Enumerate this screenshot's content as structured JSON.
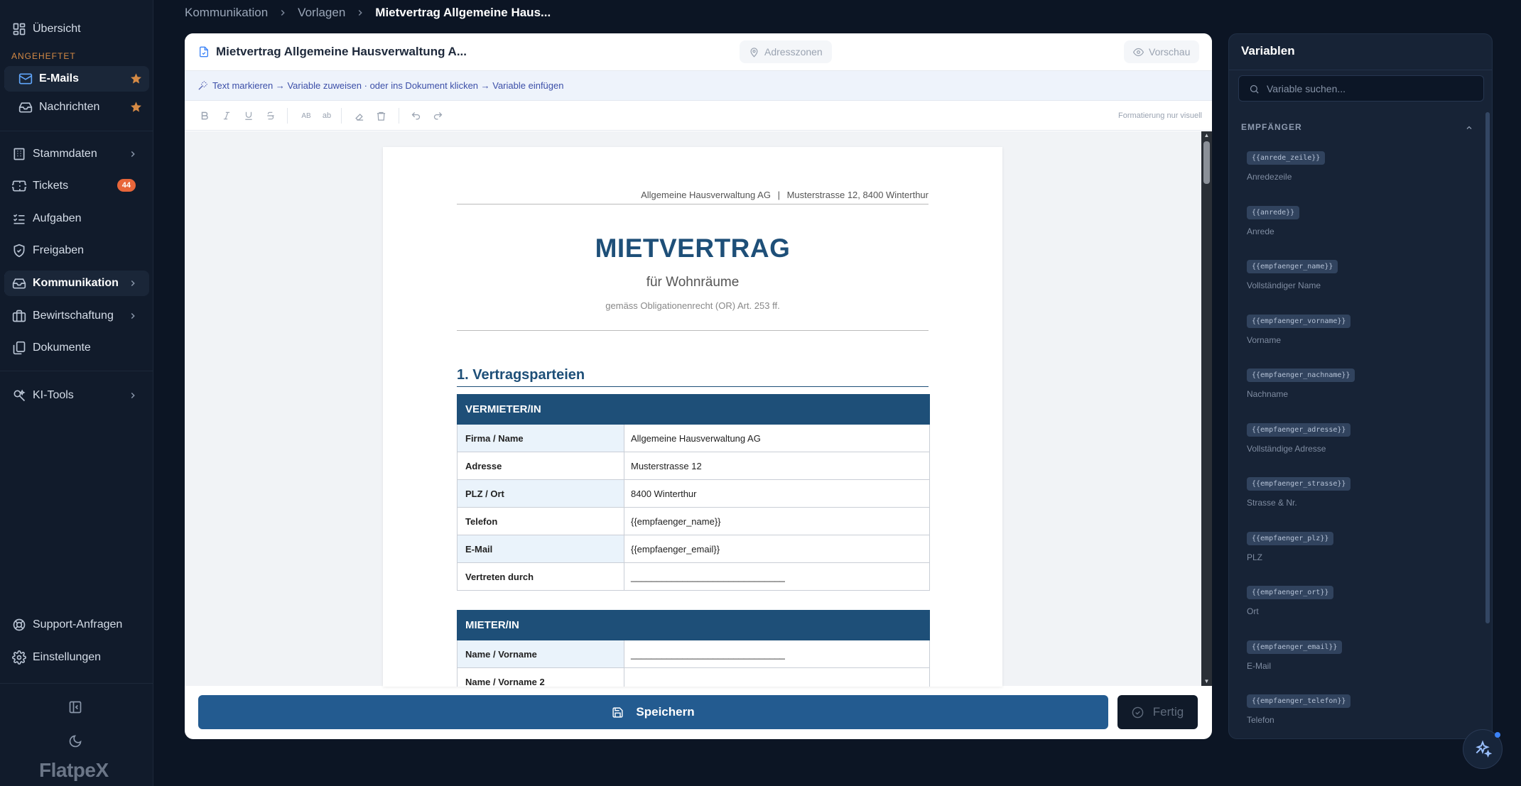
{
  "sidebar": {
    "overview": "Übersicht",
    "pinned_label": "ANGEHEFTET",
    "emails": "E-Mails",
    "messages": "Nachrichten",
    "master_data": "Stammdaten",
    "tickets": "Tickets",
    "tickets_count": "44",
    "tasks": "Aufgaben",
    "approvals": "Freigaben",
    "communication": "Kommunikation",
    "management": "Bewirtschaftung",
    "documents": "Dokumente",
    "ai_tools": "KI-Tools",
    "support": "Support-Anfragen",
    "settings": "Einstellungen",
    "logo": "FlatpeX"
  },
  "breadcrumb": [
    "Kommunikation",
    "Vorlagen",
    "Mietvertrag Allgemeine Haus..."
  ],
  "editor": {
    "title": "Mietvertrag Allgemeine Hausverwaltung A...",
    "zones_button": "Adresszonen",
    "preview_button": "Vorschau",
    "hint": "Text markieren → Variable zuweisen · oder ins Dokument klicken → Variable einfügen",
    "toolbar": {
      "upper": "AB",
      "lower": "ab",
      "note": "Formatierung nur visuell"
    },
    "save_button": "Speichern",
    "done_button": "Fertig"
  },
  "document": {
    "header_company": "Allgemeine Hausverwaltung AG",
    "header_sep": "|",
    "header_address": "Musterstrasse 12, 8400 Winterthur",
    "title": "MIETVERTRAG",
    "subtitle": "für Wohnräume",
    "legal": "gemäss Obligationenrecht (OR) Art. 253 ff.",
    "section1": "1.  Vertragsparteien",
    "landlord_header": "VERMIETER/IN",
    "landlord_rows": [
      {
        "label": "Firma / Name",
        "value": "Allgemeine Hausverwaltung AG"
      },
      {
        "label": "Adresse",
        "value": "Musterstrasse 12"
      },
      {
        "label": "PLZ / Ort",
        "value": "8400 Winterthur"
      },
      {
        "label": "Telefon",
        "value": "{{empfaenger_name}}"
      },
      {
        "label": "E-Mail",
        "value": "{{empfaenger_email}}"
      },
      {
        "label": "Vertreten durch",
        "value": "______________________________"
      }
    ],
    "tenant_header": "MIETER/IN",
    "tenant_rows": [
      {
        "label": "Name / Vorname",
        "value": "______________________________"
      },
      {
        "label": "Name / Vorname 2",
        "value": ""
      }
    ]
  },
  "variables": {
    "title": "Variablen",
    "search_placeholder": "Variable suchen...",
    "group": "EMPFÄNGER",
    "items": [
      {
        "tag": "{{anrede_zeile}}",
        "desc": "Anredezeile"
      },
      {
        "tag": "{{anrede}}",
        "desc": "Anrede"
      },
      {
        "tag": "{{empfaenger_name}}",
        "desc": "Vollständiger Name"
      },
      {
        "tag": "{{empfaenger_vorname}}",
        "desc": "Vorname"
      },
      {
        "tag": "{{empfaenger_nachname}}",
        "desc": "Nachname"
      },
      {
        "tag": "{{empfaenger_adresse}}",
        "desc": "Vollständige Adresse"
      },
      {
        "tag": "{{empfaenger_strasse}}",
        "desc": "Strasse & Nr."
      },
      {
        "tag": "{{empfaenger_plz}}",
        "desc": "PLZ"
      },
      {
        "tag": "{{empfaenger_ort}}",
        "desc": "Ort"
      },
      {
        "tag": "{{empfaenger_email}}",
        "desc": "E-Mail"
      },
      {
        "tag": "{{empfaenger_telefon}}",
        "desc": "Telefon"
      }
    ]
  },
  "colors": {
    "accent": "#3b82f6",
    "primary": "#235b90",
    "doc_blue": "#1e4f78",
    "badge": "#e8663a",
    "pinned_label": "#d58a45"
  }
}
